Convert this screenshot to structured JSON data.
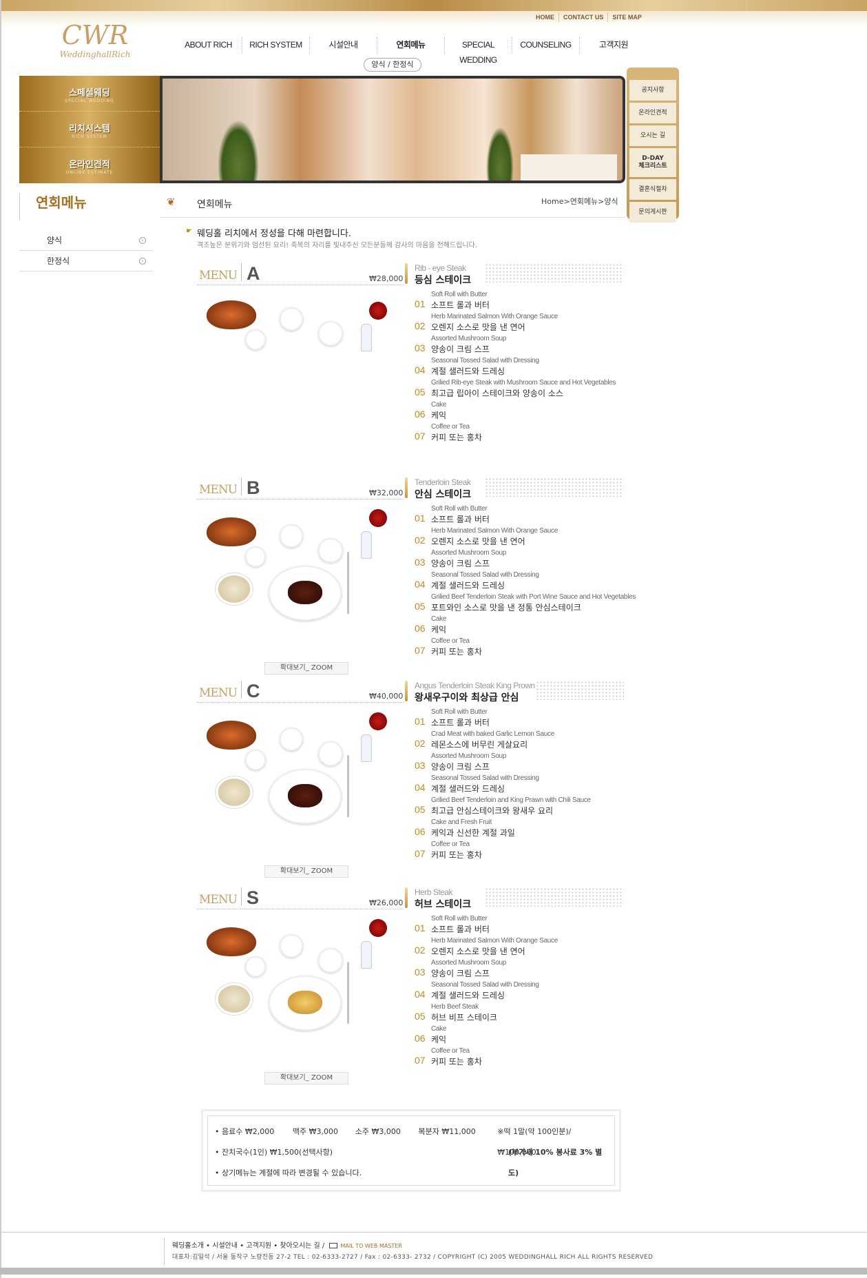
{
  "util": [
    "HOME",
    "CONTACT US",
    "SITE MAP"
  ],
  "logo": {
    "mono": "CWR",
    "word": "WeddinghallRich"
  },
  "gnb": [
    "ABOUT RICH",
    "RICH SYSTEM",
    "시설안내",
    "연회메뉴",
    "SPECIAL WEDDING",
    "COUNSELING",
    "고객지원"
  ],
  "subnav": "양식 / 한정식",
  "quick": [
    {
      "ko": "스페셜웨딩",
      "en": "SPECIAL WEDDING"
    },
    {
      "ko": "리치시스템",
      "en": "RICH SYSTEM"
    },
    {
      "ko": "온라인견적",
      "en": "ONLINE ESTIMATE"
    }
  ],
  "right_side": [
    "공지사항",
    "온라인견적",
    "오시는 길",
    "D-DAY\n체크리스트",
    "결혼식절차",
    "문의게시판"
  ],
  "lnb": {
    "title": "연회메뉴",
    "items": [
      "양식",
      "한정식"
    ]
  },
  "content": {
    "title": "연회메뉴",
    "location": "Home>연회메뉴>양식",
    "intro_title": "웨딩홀 리치에서 정성을 다해 마련합니다.",
    "intro_text": "격조높은 분위기와 엄선된 요리!  축복의 자리를 빛내주신 모든분들께 감사의 마음을 전해드립니다.",
    "zoom_label": "확대보기_ ZOOM",
    "menu_word": "MENU"
  },
  "menus": [
    {
      "letter": "A",
      "price": "₩28,000",
      "name_en": "Rib - eye Steak",
      "name_ko": "등심 스테이크",
      "courses": [
        {
          "no": "01",
          "en": "Soft Roll with Butter",
          "ko": "소프트 롤과 버터"
        },
        {
          "no": "02",
          "en": "Herb Marinated Salmon With Orange Sauce",
          "ko": "오렌지 소스로 맛을 낸 연어"
        },
        {
          "no": "03",
          "en": "Assorted Mushroom Soup",
          "ko": "양송이 크림 스프"
        },
        {
          "no": "04",
          "en": "Seasonal Tossed Salad with Dressing",
          "ko": "계절 샐러드와 드레싱"
        },
        {
          "no": "05",
          "en": "Grilied Rib-eye Steak with Mushroom Sauce and Hot Vegetables",
          "ko": "최고급 립아이 스테이크와 양송이 소스"
        },
        {
          "no": "06",
          "en": "Cake",
          "ko": "케익"
        },
        {
          "no": "07",
          "en": "Coffee or Tea",
          "ko": "커피 또는 홍차"
        }
      ]
    },
    {
      "letter": "B",
      "price": "₩32,000",
      "name_en": "Tenderloin Steak",
      "name_ko": "안심 스테이크",
      "courses": [
        {
          "no": "01",
          "en": "Soft Roll with Butter",
          "ko": "소프트 롤과 버터"
        },
        {
          "no": "02",
          "en": "Herb Marinated Salmon With Orange Sauce",
          "ko": "오렌지 소스로 맛을 낸 연어"
        },
        {
          "no": "03",
          "en": "Assorted Mushroom Soup",
          "ko": "양송이 크림 스프"
        },
        {
          "no": "04",
          "en": "Seasonal Tossed Salad with Dressing",
          "ko": "계절 샐러드와 드레싱"
        },
        {
          "no": "05",
          "en": "Grilied Beef Tenderloin Steak with Port Wine Sauce and Hot Vegetables",
          "ko": "포트와인 소스로 맛을 낸 정통 안심스테이크"
        },
        {
          "no": "06",
          "en": "Cake",
          "ko": "케익"
        },
        {
          "no": "07",
          "en": "Coffee or Tea",
          "ko": "커피 또는 홍차"
        }
      ]
    },
    {
      "letter": "C",
      "price": "₩40,000",
      "name_en": "Angus Tenderloin Steak King Prown",
      "name_ko": "왕새우구이와 최상급 안심",
      "courses": [
        {
          "no": "01",
          "en": "Soft Roll with Butter",
          "ko": "소프트 롤과 버터"
        },
        {
          "no": "02",
          "en": "Crad Meat with baked Garlic Lemon Sauce",
          "ko": "레몬소스에 버무린 게살요리"
        },
        {
          "no": "03",
          "en": "Assorted Mushroom Soup",
          "ko": "양송이 크림 스프"
        },
        {
          "no": "04",
          "en": "Seasonal Tossed Salad with Dressing",
          "ko": "계절 샐러드와 드레싱"
        },
        {
          "no": "05",
          "en": "Grilied Beef Tenderloin and King Prawn with Chili Sauce",
          "ko": "최고급 안심스테이크와 왕새우 요리"
        },
        {
          "no": "06",
          "en": "Cake and Fresh Fruit",
          "ko": "케익과 신선한 계절 과일"
        },
        {
          "no": "07",
          "en": "Coffee or Tea",
          "ko": "커피 또는 홍차"
        }
      ]
    },
    {
      "letter": "S",
      "price": "₩26,000",
      "name_en": "Herb  Steak",
      "name_ko": "허브 스테이크",
      "courses": [
        {
          "no": "01",
          "en": "Soft Roll with Butter",
          "ko": "소프트 롤과 버터"
        },
        {
          "no": "02",
          "en": "Herb Marinated Salmon With Orange Sauce",
          "ko": "오렌지 소스로 맛을 낸 연어"
        },
        {
          "no": "03",
          "en": "Assorted Mushroom Soup",
          "ko": "양송이 크림 스프"
        },
        {
          "no": "04",
          "en": "Seasonal Tossed Salad with Dressing",
          "ko": "계절 샐러드와 드레싱"
        },
        {
          "no": "05",
          "en": "Herb Beef Steak",
          "ko": "허브 비프 스테이크"
        },
        {
          "no": "06",
          "en": "Cake",
          "ko": "케익"
        },
        {
          "no": "07",
          "en": "Coffee or Tea",
          "ko": "커피 또는 홍차"
        }
      ]
    }
  ],
  "notes": {
    "row1": [
      "• 음료수 ₩2,000",
      "맥주 ₩3,000",
      "소주 ₩3,000",
      "복분자 ₩11,000",
      "※떡 1말(약 100인분)/ ₩100,000"
    ],
    "row2_left": "• 잔치국수(1인) ₩1,500(선택사항)",
    "row2_right": "(부가세 10% 봉사료 3% 별도)",
    "row3": "• 상기메뉴는 계절에 따라 변경될 수 있습니다."
  },
  "footer": {
    "links": "웨딩홀소개  • 시설안내  •  고객지원  •  찾아오시는 길   /",
    "mail": "MAIL TO WEB MASTER",
    "info": "대표자:김일석 / 서울 동작구 노량진동 27-2    TEL : 02-6333-2727  /  Fax : 02-6333- 2732   /   COPYRIGHT (C) 2005 WEDDINGHALL RICH  ALL RIGHTS RESERVED"
  }
}
